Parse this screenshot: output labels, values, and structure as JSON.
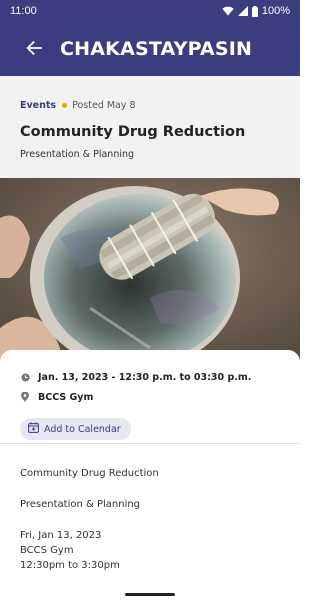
{
  "status_bar": {
    "time": "11:00",
    "battery": "100%"
  },
  "app_bar": {
    "title": "CHAKASTAYPASIN"
  },
  "event": {
    "category": "Events",
    "posted": "Posted May 8",
    "title": "Community Drug Reduction",
    "subtitle": "Presentation & Planning",
    "datetime": "Jan. 13, 2023 - 12:30 p.m. to 03:30 p.m.",
    "location": "BCCS Gym",
    "add_calendar_label": "Add to Calendar"
  },
  "details": {
    "title": "Community Drug Reduction",
    "subtitle": "Presentation & Planning",
    "date": "Fri, Jan 13, 2023",
    "location": "BCCS Gym",
    "time": "12:30pm to 3:30pm"
  },
  "colors": {
    "brand": "#3b3e7e",
    "accent_dot": "#f0a500",
    "chip_bg": "#e6e7f2"
  },
  "icons": [
    "wifi-icon",
    "signal-icon",
    "battery-icon",
    "back-arrow-icon",
    "clock-icon",
    "location-pin-icon",
    "calendar-add-icon"
  ]
}
